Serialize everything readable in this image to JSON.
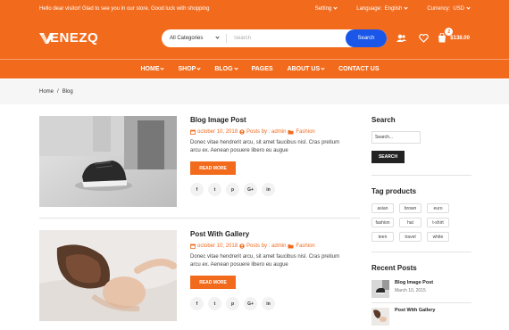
{
  "topbar": {
    "welcome": "Hello dear visitor! Glad to see you in our store. Good luck with shopping",
    "setting_label": "Setting",
    "language_label": "Language:",
    "language_value": "English",
    "currency_label": "Currency:",
    "currency_value": "USD"
  },
  "header": {
    "logo_text": "ENEZQ",
    "search": {
      "category": "All Categories",
      "placeholder": "Search",
      "button": "Search"
    },
    "icons": [
      "user-icon",
      "heart-icon",
      "cart-icon"
    ],
    "cart_count": "2",
    "cart_total": "$138.00"
  },
  "nav": {
    "items": [
      {
        "label": "HOME",
        "dropdown": true
      },
      {
        "label": "SHOP",
        "dropdown": true
      },
      {
        "label": "BLOG",
        "dropdown": true
      },
      {
        "label": "PAGES",
        "dropdown": false
      },
      {
        "label": "ABOUT US",
        "dropdown": true
      },
      {
        "label": "CONTACT US",
        "dropdown": false
      }
    ]
  },
  "breadcrumb": {
    "home": "Home",
    "separator": "/",
    "current": "Blog"
  },
  "posts": [
    {
      "title": "Blog Image Post",
      "date": "october 10, 2018",
      "author": "Posts by : admin",
      "category": "Fashion",
      "excerpt": "Donec vitae hendrerit arcu, sit amet faucibus nisl. Cras pretium arcu ex. Aenean posuere libero eu augue",
      "read_more": "READ MORE",
      "share": [
        "f",
        "t",
        "p",
        "G+",
        "in"
      ]
    },
    {
      "title": "Post With Gallery",
      "date": "october 10, 2018",
      "author": "Posts by : admin",
      "category": "Fashion",
      "excerpt": "Donec vitae hendrerit arcu, sit amet faucibus nisl. Cras pretium arcu ex. Aenean posuere libero eu augue",
      "read_more": "READ MORE",
      "share": [
        "f",
        "t",
        "p",
        "G+",
        "in"
      ]
    }
  ],
  "sidebar": {
    "search_title": "Search",
    "search_placeholder": "Search...",
    "search_button": "SEARCH",
    "tags_title": "Tag products",
    "tags": [
      "asian",
      "brown",
      "euro",
      "fashion",
      "hat",
      "t-shirt",
      "teen",
      "travel",
      "white"
    ],
    "recent_title": "Recent Posts",
    "recent_posts": [
      {
        "title": "Blog Image Post",
        "date": "March 10, 2015"
      },
      {
        "title": "Post With Gallery",
        "date": ""
      }
    ]
  },
  "colors": {
    "brand": "#f26b1d",
    "search_button": "#1a56e8"
  }
}
